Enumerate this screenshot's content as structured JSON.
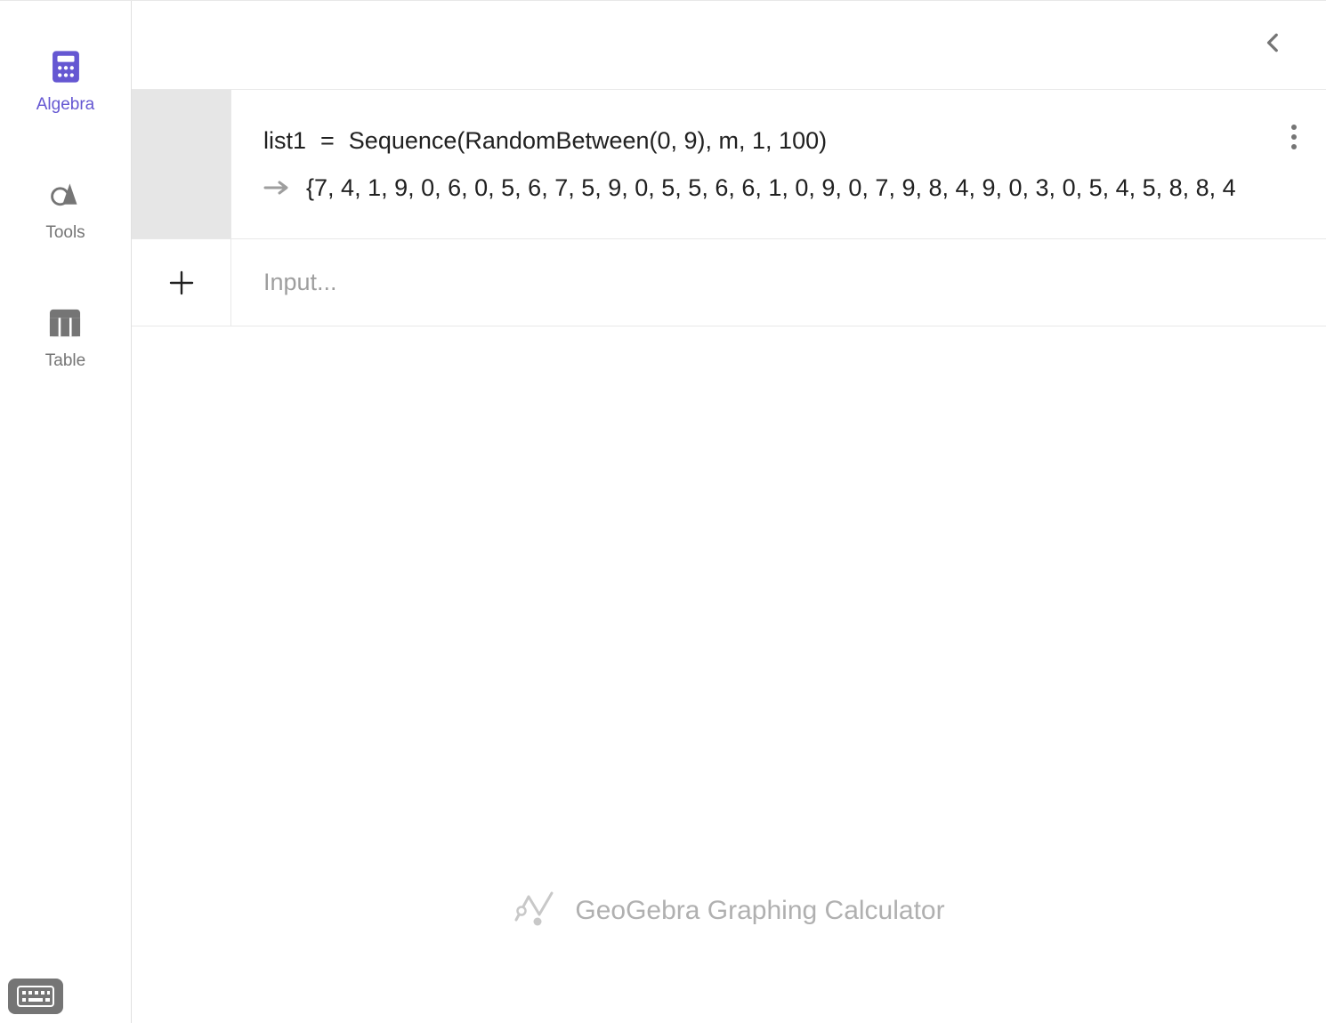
{
  "sidebar": {
    "items": [
      {
        "label": "Algebra",
        "active": true
      },
      {
        "label": "Tools",
        "active": false
      },
      {
        "label": "Table",
        "active": false
      }
    ]
  },
  "expression": {
    "name": "list1",
    "definition": "Sequence(RandomBetween(0, 9), m, 1, 100)",
    "resultPrefix": "{",
    "resultValues": "7, 4, 1, 9, 0, 6, 0, 5, 6, 7, 5, 9, 0, 5, 5, 6, 6, 1, 0, 9, 0, 7, 9, 8, 4, 9, 0, 3, 0, 5, 4, 5, 8, 8, 4"
  },
  "inputRow": {
    "placeholder": "Input..."
  },
  "brand": {
    "name": "GeoGebra Graphing Calculator"
  }
}
